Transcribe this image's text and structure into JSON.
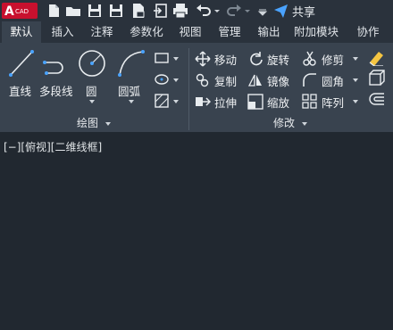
{
  "app": {
    "logo_letter": "A",
    "logo_text": "CAD"
  },
  "qat": {
    "share_label": "共享"
  },
  "tabs": [
    {
      "label": "默认",
      "active": true
    },
    {
      "label": "插入"
    },
    {
      "label": "注释"
    },
    {
      "label": "参数化"
    },
    {
      "label": "视图"
    },
    {
      "label": "管理"
    },
    {
      "label": "输出"
    },
    {
      "label": "附加模块"
    },
    {
      "label": "协作"
    }
  ],
  "draw_panel": {
    "title": "绘图",
    "tools": [
      {
        "label": "直线",
        "icon": "line-icon"
      },
      {
        "label": "多段线",
        "icon": "polyline-icon"
      },
      {
        "label": "圆",
        "icon": "circle-icon"
      },
      {
        "label": "圆弧",
        "icon": "arc-icon"
      }
    ]
  },
  "modify_panel": {
    "title": "修改",
    "items": [
      {
        "label": "移动",
        "icon": "move-icon"
      },
      {
        "label": "旋转",
        "icon": "rotate-icon"
      },
      {
        "label": "修剪",
        "icon": "trim-icon"
      },
      {
        "label": "复制",
        "icon": "copy-icon"
      },
      {
        "label": "镜像",
        "icon": "mirror-icon"
      },
      {
        "label": "圆角",
        "icon": "fillet-icon"
      },
      {
        "label": "拉伸",
        "icon": "stretch-icon"
      },
      {
        "label": "缩放",
        "icon": "scale-icon"
      },
      {
        "label": "阵列",
        "icon": "array-icon"
      }
    ]
  },
  "viewport": {
    "label": "[−][俯视][二维线框]"
  },
  "colors": {
    "background": "#212830",
    "ribbon": "#39434f",
    "title_bar": "#2a323c",
    "logo_red": "#c8102e",
    "accent_yellow": "#f5c542",
    "accent_blue": "#4aa3ff"
  }
}
